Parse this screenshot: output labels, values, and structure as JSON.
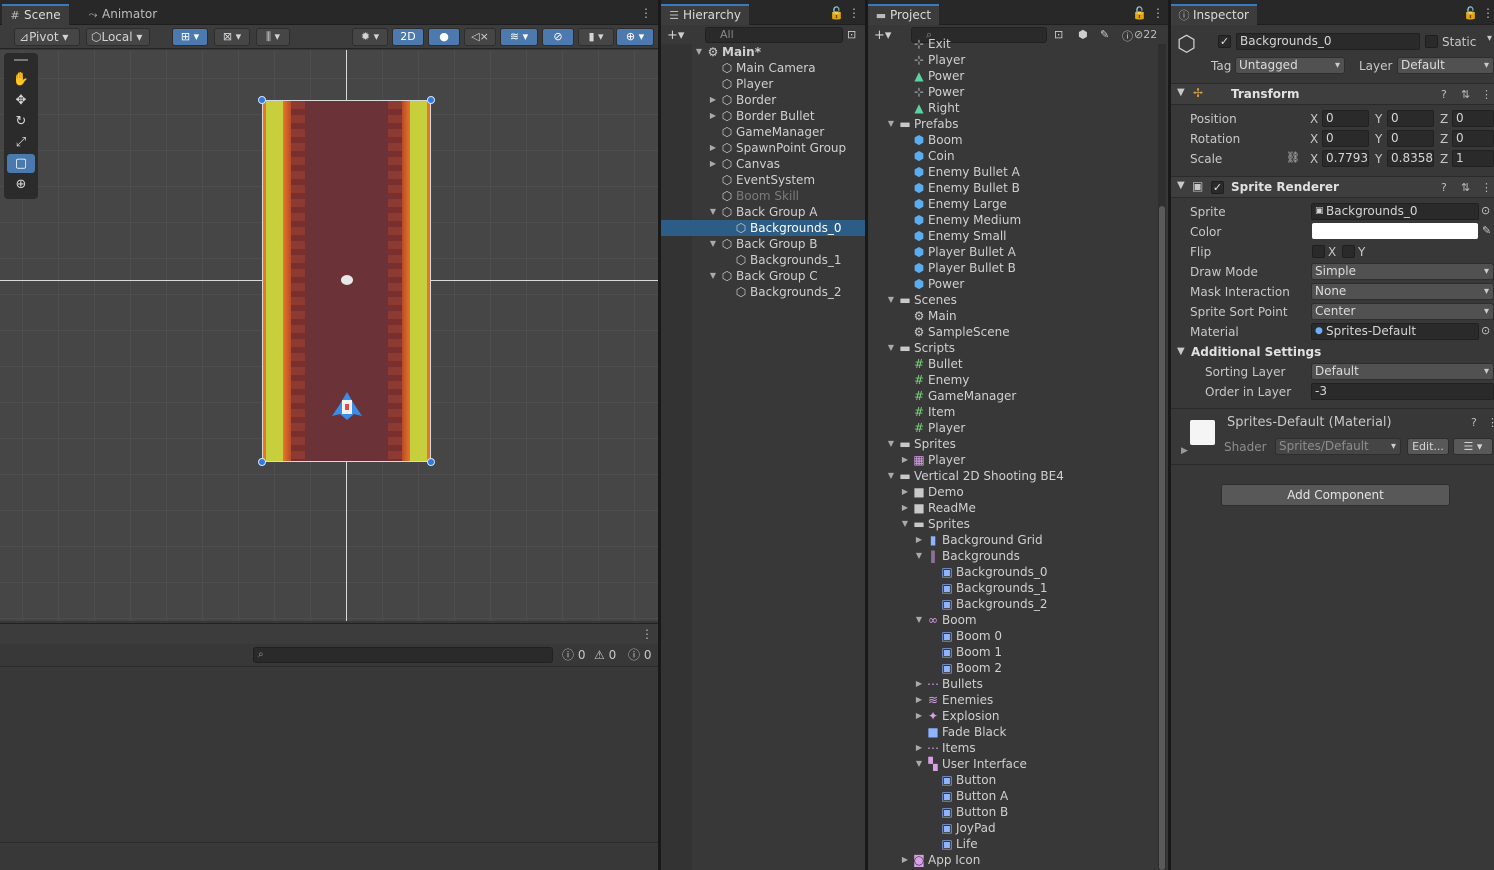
{
  "scene_panel": {
    "tabs": [
      {
        "label": "Scene"
      },
      {
        "label": "Animator"
      }
    ],
    "toolbar": {
      "pivot": "Pivot",
      "local": "Local",
      "mode_2d": "2D"
    },
    "console": {
      "search_placeholder": "",
      "log_count": "0",
      "warn_count": "0",
      "error_count": "0"
    }
  },
  "hierarchy": {
    "tab_label": "Hierarchy",
    "search_placeholder": "All",
    "rows": [
      {
        "label": "Main*",
        "depth": 0,
        "arrow": "▼",
        "icon": "unity-scene-icon",
        "glyph": "⚙",
        "bold": true
      },
      {
        "label": "Main Camera",
        "depth": 1,
        "arrow": "",
        "icon": "gameobject-icon",
        "glyph": "⬡"
      },
      {
        "label": "Player",
        "depth": 1,
        "arrow": "",
        "icon": "gameobject-icon",
        "glyph": "⬡"
      },
      {
        "label": "Border",
        "depth": 1,
        "arrow": "▶",
        "icon": "gameobject-icon",
        "glyph": "⬡"
      },
      {
        "label": "Border Bullet",
        "depth": 1,
        "arrow": "▶",
        "icon": "gameobject-icon",
        "glyph": "⬡"
      },
      {
        "label": "GameManager",
        "depth": 1,
        "arrow": "",
        "icon": "gameobject-icon",
        "glyph": "⬡"
      },
      {
        "label": "SpawnPoint Group",
        "depth": 1,
        "arrow": "▶",
        "icon": "gameobject-icon",
        "glyph": "⬡"
      },
      {
        "label": "Canvas",
        "depth": 1,
        "arrow": "▶",
        "icon": "gameobject-icon",
        "glyph": "⬡"
      },
      {
        "label": "EventSystem",
        "depth": 1,
        "arrow": "",
        "icon": "gameobject-icon",
        "glyph": "⬡"
      },
      {
        "label": "Boom Skill",
        "depth": 1,
        "arrow": "",
        "icon": "gameobject-icon",
        "glyph": "⬡",
        "dim": true
      },
      {
        "label": "Back Group A",
        "depth": 1,
        "arrow": "▼",
        "icon": "gameobject-icon",
        "glyph": "⬡"
      },
      {
        "label": "Backgrounds_0",
        "depth": 2,
        "arrow": "",
        "icon": "gameobject-icon",
        "glyph": "⬡",
        "selected": true
      },
      {
        "label": "Back Group B",
        "depth": 1,
        "arrow": "▼",
        "icon": "gameobject-icon",
        "glyph": "⬡"
      },
      {
        "label": "Backgrounds_1",
        "depth": 2,
        "arrow": "",
        "icon": "gameobject-icon",
        "glyph": "⬡"
      },
      {
        "label": "Back Group C",
        "depth": 1,
        "arrow": "▼",
        "icon": "gameobject-icon",
        "glyph": "⬡"
      },
      {
        "label": "Backgrounds_2",
        "depth": 2,
        "arrow": "",
        "icon": "gameobject-icon",
        "glyph": "⬡"
      }
    ]
  },
  "project": {
    "tab_label": "Project",
    "hidden_count": "22",
    "rows": [
      {
        "label": "Exit",
        "depth": 2,
        "arrow": "",
        "icon": "animation-icon",
        "glyph": "⊹"
      },
      {
        "label": "Player",
        "depth": 2,
        "arrow": "",
        "icon": "animation-icon",
        "glyph": "⊹"
      },
      {
        "label": "Power",
        "depth": 2,
        "arrow": "",
        "icon": "animator-controller-icon",
        "glyph": "▲"
      },
      {
        "label": "Power",
        "depth": 2,
        "arrow": "",
        "icon": "animation-icon",
        "glyph": "⊹"
      },
      {
        "label": "Right",
        "depth": 2,
        "arrow": "",
        "icon": "animator-controller-icon",
        "glyph": "▲"
      },
      {
        "label": "Prefabs",
        "depth": 1,
        "arrow": "▼",
        "icon": "folder-open-icon",
        "glyph": "▬"
      },
      {
        "label": "Boom",
        "depth": 2,
        "arrow": "",
        "icon": "prefab-icon",
        "glyph": "⬢"
      },
      {
        "label": "Coin",
        "depth": 2,
        "arrow": "",
        "icon": "prefab-icon",
        "glyph": "⬢"
      },
      {
        "label": "Enemy Bullet A",
        "depth": 2,
        "arrow": "",
        "icon": "prefab-icon",
        "glyph": "⬢"
      },
      {
        "label": "Enemy Bullet B",
        "depth": 2,
        "arrow": "",
        "icon": "prefab-icon",
        "glyph": "⬢"
      },
      {
        "label": "Enemy Large",
        "depth": 2,
        "arrow": "",
        "icon": "prefab-icon",
        "glyph": "⬢"
      },
      {
        "label": "Enemy Medium",
        "depth": 2,
        "arrow": "",
        "icon": "prefab-icon",
        "glyph": "⬢"
      },
      {
        "label": "Enemy Small",
        "depth": 2,
        "arrow": "",
        "icon": "prefab-icon",
        "glyph": "⬢"
      },
      {
        "label": "Player Bullet A",
        "depth": 2,
        "arrow": "",
        "icon": "prefab-icon",
        "glyph": "⬢"
      },
      {
        "label": "Player Bullet B",
        "depth": 2,
        "arrow": "",
        "icon": "prefab-icon",
        "glyph": "⬢"
      },
      {
        "label": "Power",
        "depth": 2,
        "arrow": "",
        "icon": "prefab-icon",
        "glyph": "⬢"
      },
      {
        "label": "Scenes",
        "depth": 1,
        "arrow": "▼",
        "icon": "folder-open-icon",
        "glyph": "▬"
      },
      {
        "label": "Main",
        "depth": 2,
        "arrow": "",
        "icon": "unity-scene-icon",
        "glyph": "⚙"
      },
      {
        "label": "SampleScene",
        "depth": 2,
        "arrow": "",
        "icon": "unity-scene-icon",
        "glyph": "⚙"
      },
      {
        "label": "Scripts",
        "depth": 1,
        "arrow": "▼",
        "icon": "folder-open-icon",
        "glyph": "▬"
      },
      {
        "label": "Bullet",
        "depth": 2,
        "arrow": "",
        "icon": "csharp-script-icon",
        "glyph": "#"
      },
      {
        "label": "Enemy",
        "depth": 2,
        "arrow": "",
        "icon": "csharp-script-icon",
        "glyph": "#"
      },
      {
        "label": "GameManager",
        "depth": 2,
        "arrow": "",
        "icon": "csharp-script-icon",
        "glyph": "#"
      },
      {
        "label": "Item",
        "depth": 2,
        "arrow": "",
        "icon": "csharp-script-icon",
        "glyph": "#"
      },
      {
        "label": "Player",
        "depth": 2,
        "arrow": "",
        "icon": "csharp-script-icon",
        "glyph": "#"
      },
      {
        "label": "Sprites",
        "depth": 1,
        "arrow": "▼",
        "icon": "folder-open-icon",
        "glyph": "▬"
      },
      {
        "label": "Player",
        "depth": 2,
        "arrow": "▶",
        "icon": "sprite-sheet-icon",
        "glyph": "▦"
      },
      {
        "label": "Vertical 2D Shooting BE4",
        "depth": 1,
        "arrow": "▼",
        "icon": "folder-open-icon",
        "glyph": "▬"
      },
      {
        "label": "Demo",
        "depth": 2,
        "arrow": "▶",
        "icon": "folder-icon",
        "glyph": "■"
      },
      {
        "label": "ReadMe",
        "depth": 2,
        "arrow": "▶",
        "icon": "folder-icon",
        "glyph": "■"
      },
      {
        "label": "Sprites",
        "depth": 2,
        "arrow": "▼",
        "icon": "folder-open-icon",
        "glyph": "▬"
      },
      {
        "label": "Background Grid",
        "depth": 3,
        "arrow": "▶",
        "icon": "sprite-icon",
        "glyph": "▮"
      },
      {
        "label": "Backgrounds",
        "depth": 3,
        "arrow": "▼",
        "icon": "sprite-sheet-icon",
        "glyph": "‖"
      },
      {
        "label": "Backgrounds_0",
        "depth": 4,
        "arrow": "",
        "icon": "sprite-icon",
        "glyph": "▣"
      },
      {
        "label": "Backgrounds_1",
        "depth": 4,
        "arrow": "",
        "icon": "sprite-icon",
        "glyph": "▣"
      },
      {
        "label": "Backgrounds_2",
        "depth": 4,
        "arrow": "",
        "icon": "sprite-icon",
        "glyph": "▣"
      },
      {
        "label": "Boom",
        "depth": 3,
        "arrow": "▼",
        "icon": "sprite-sheet-icon",
        "glyph": "∞"
      },
      {
        "label": "Boom 0",
        "depth": 4,
        "arrow": "",
        "icon": "sprite-icon",
        "glyph": "▣"
      },
      {
        "label": "Boom 1",
        "depth": 4,
        "arrow": "",
        "icon": "sprite-icon",
        "glyph": "▣"
      },
      {
        "label": "Boom 2",
        "depth": 4,
        "arrow": "",
        "icon": "sprite-icon",
        "glyph": "▣"
      },
      {
        "label": "Bullets",
        "depth": 3,
        "arrow": "▶",
        "icon": "sprite-sheet-icon",
        "glyph": "⋯"
      },
      {
        "label": "Enemies",
        "depth": 3,
        "arrow": "▶",
        "icon": "sprite-sheet-icon",
        "glyph": "≋"
      },
      {
        "label": "Explosion",
        "depth": 3,
        "arrow": "▶",
        "icon": "sprite-sheet-icon",
        "glyph": "✦"
      },
      {
        "label": "Fade Black",
        "depth": 3,
        "arrow": "",
        "icon": "sprite-icon",
        "glyph": "■"
      },
      {
        "label": "Items",
        "depth": 3,
        "arrow": "▶",
        "icon": "sprite-sheet-icon",
        "glyph": "⋯"
      },
      {
        "label": "User Interface",
        "depth": 3,
        "arrow": "▼",
        "icon": "sprite-sheet-icon",
        "glyph": "▚"
      },
      {
        "label": "Button",
        "depth": 4,
        "arrow": "",
        "icon": "sprite-icon",
        "glyph": "▣"
      },
      {
        "label": "Button A",
        "depth": 4,
        "arrow": "",
        "icon": "sprite-icon",
        "glyph": "▣"
      },
      {
        "label": "Button B",
        "depth": 4,
        "arrow": "",
        "icon": "sprite-icon",
        "glyph": "▣"
      },
      {
        "label": "JoyPad",
        "depth": 4,
        "arrow": "",
        "icon": "sprite-icon",
        "glyph": "▣"
      },
      {
        "label": "Life",
        "depth": 4,
        "arrow": "",
        "icon": "sprite-icon",
        "glyph": "▣"
      },
      {
        "label": "App Icon",
        "depth": 2,
        "arrow": "▶",
        "icon": "sprite-sheet-icon",
        "glyph": "◙"
      }
    ]
  },
  "inspector": {
    "tab_label": "Inspector",
    "object_name": "Backgrounds_0",
    "static_label": "Static",
    "tag_label": "Tag",
    "tag_value": "Untagged",
    "layer_label": "Layer",
    "layer_value": "Default",
    "transform": {
      "title": "Transform",
      "position_label": "Position",
      "position": {
        "x": "0",
        "y": "0",
        "z": "0"
      },
      "rotation_label": "Rotation",
      "rotation": {
        "x": "0",
        "y": "0",
        "z": "0"
      },
      "scale_label": "Scale",
      "scale": {
        "x": "0.7793",
        "y": "0.8358",
        "z": "1"
      }
    },
    "sprite_renderer": {
      "title": "Sprite Renderer",
      "sprite_label": "Sprite",
      "sprite_value": "Backgrounds_0",
      "color_label": "Color",
      "color_value": "#ffffff",
      "flip_label": "Flip",
      "flip_x": "X",
      "flip_y": "Y",
      "draw_mode_label": "Draw Mode",
      "draw_mode_value": "Simple",
      "mask_label": "Mask Interaction",
      "mask_value": "None",
      "sort_point_label": "Sprite Sort Point",
      "sort_point_value": "Center",
      "material_label": "Material",
      "material_value": "Sprites-Default",
      "additional_label": "Additional Settings",
      "sorting_layer_label": "Sorting Layer",
      "sorting_layer_value": "Default",
      "order_label": "Order in Layer",
      "order_value": "-3"
    },
    "material": {
      "title": "Sprites-Default (Material)",
      "shader_label": "Shader",
      "shader_value": "Sprites/Default",
      "edit_label": "Edit..."
    },
    "add_component_label": "Add Component"
  },
  "colors": {
    "accent": "#3a79bb",
    "selection": "#2c5d87",
    "panel": "#383838"
  }
}
